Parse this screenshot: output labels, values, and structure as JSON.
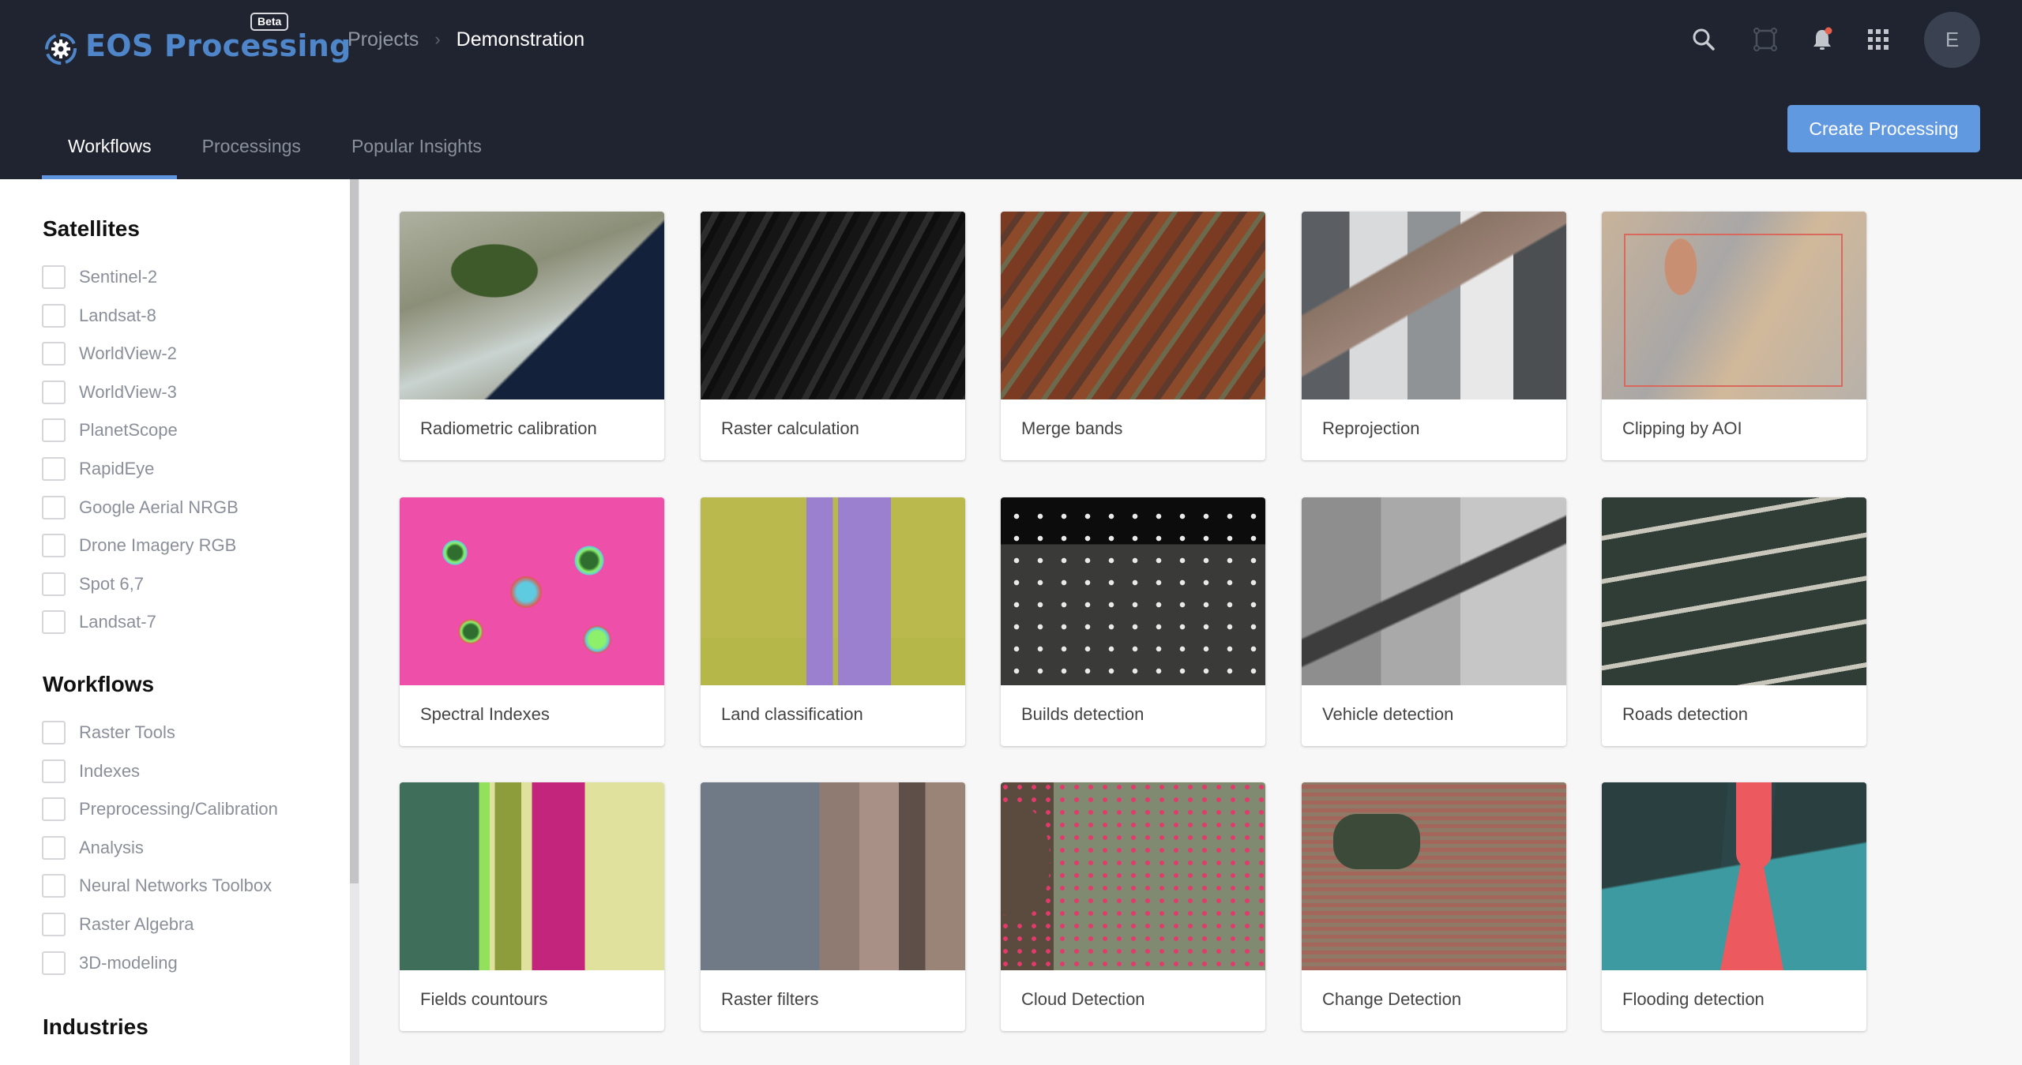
{
  "header": {
    "brand": "EOS Processing",
    "beta_badge": "Beta",
    "breadcrumb": {
      "parent": "Projects",
      "separator": "›",
      "current": "Demonstration"
    },
    "icons": [
      "search-icon",
      "draw-area-icon",
      "notifications-icon",
      "apps-grid-icon"
    ],
    "notification_dot_color": "#e8614f",
    "avatar_initial": "E",
    "tabs": [
      {
        "label": "Workflows",
        "active": true
      },
      {
        "label": "Processings",
        "active": false
      },
      {
        "label": "Popular Insights",
        "active": false
      }
    ],
    "create_button": "Create Processing",
    "accent_color": "#6199e0"
  },
  "sidebar": {
    "sections": [
      {
        "title": "Satellites",
        "items": [
          {
            "label": "Sentinel-2",
            "checked": false
          },
          {
            "label": "Landsat-8",
            "checked": false
          },
          {
            "label": "WorldView-2",
            "checked": false
          },
          {
            "label": "WorldView-3",
            "checked": false
          },
          {
            "label": "PlanetScope",
            "checked": false
          },
          {
            "label": "RapidEye",
            "checked": false
          },
          {
            "label": "Google Aerial NRGB",
            "checked": false
          },
          {
            "label": "Drone Imagery RGB",
            "checked": false
          },
          {
            "label": "Spot 6,7",
            "checked": false
          },
          {
            "label": "Landsat-7",
            "checked": false
          }
        ]
      },
      {
        "title": "Workflows",
        "items": [
          {
            "label": "Raster Tools",
            "checked": false
          },
          {
            "label": "Indexes",
            "checked": false
          },
          {
            "label": "Preprocessing/Calibration",
            "checked": false
          },
          {
            "label": "Analysis",
            "checked": false
          },
          {
            "label": "Neural Networks Toolbox",
            "checked": false
          },
          {
            "label": "Raster Algebra",
            "checked": false
          },
          {
            "label": "3D-modeling",
            "checked": false
          }
        ]
      },
      {
        "title": "Industries",
        "items": []
      }
    ]
  },
  "workflows": [
    {
      "label": "Radiometric calibration",
      "thumb": "radiometric"
    },
    {
      "label": "Raster calculation",
      "thumb": "raster-calc"
    },
    {
      "label": "Merge bands",
      "thumb": "merge"
    },
    {
      "label": "Reprojection",
      "thumb": "reproj"
    },
    {
      "label": "Clipping by AOI",
      "thumb": "clip"
    },
    {
      "label": "Spectral Indexes",
      "thumb": "spectral"
    },
    {
      "label": "Land classification",
      "thumb": "landclass"
    },
    {
      "label": "Builds detection",
      "thumb": "builds"
    },
    {
      "label": "Vehicle detection",
      "thumb": "vehicle"
    },
    {
      "label": "Roads detection",
      "thumb": "roads"
    },
    {
      "label": "Fields countours",
      "thumb": "fields"
    },
    {
      "label": "Raster filters",
      "thumb": "filters"
    },
    {
      "label": "Cloud Detection",
      "thumb": "cloud"
    },
    {
      "label": "Change Detection",
      "thumb": "change"
    },
    {
      "label": "Flooding detection",
      "thumb": "flood"
    }
  ]
}
